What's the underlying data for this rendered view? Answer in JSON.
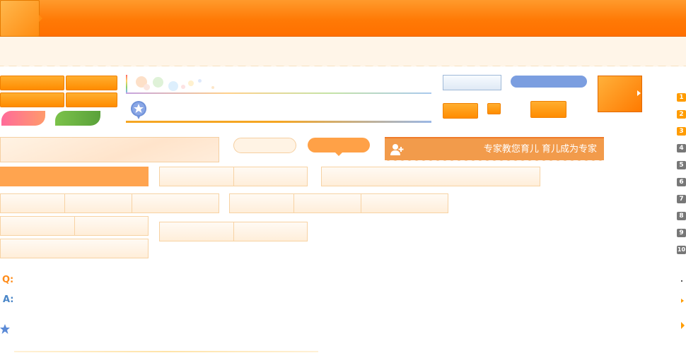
{
  "banner": {
    "text": "专家教您育儿  育儿成为专家"
  },
  "qa": {
    "q_label": "Q:",
    "a_label": "A:"
  },
  "number_badges": [
    "1",
    "2",
    "3",
    "4",
    "5",
    "6",
    "7",
    "8",
    "9",
    "10"
  ],
  "colors": {
    "orange": "#ff8c00",
    "orange_dark": "#e86500",
    "peach_border": "#f7d2a3",
    "blue": "#7b9ee0",
    "badge_orange": "#ff9c00",
    "badge_gray": "#777777"
  },
  "icons": {
    "banner_icon": "add-user-icon",
    "pin_icon": "star-pin-icon",
    "star_icon": "star-icon",
    "arrow_icon": "arrow-right-icon"
  }
}
